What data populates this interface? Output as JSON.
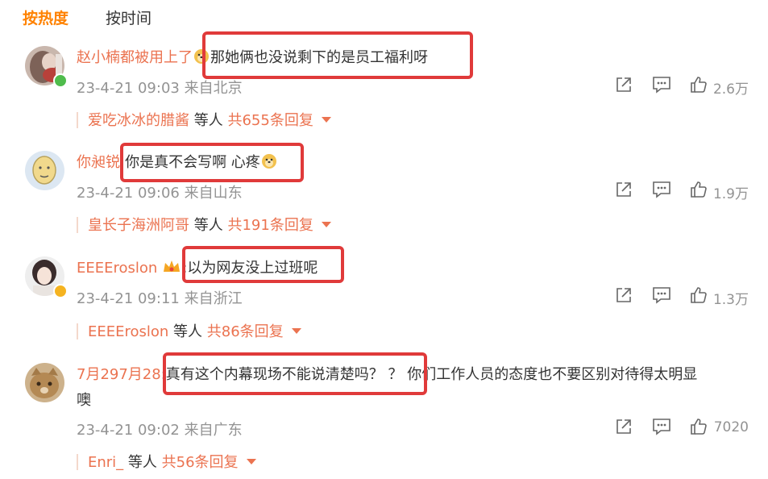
{
  "tabs": {
    "hot": "按热度",
    "time": "按时间"
  },
  "colors": {
    "accent": "#ff8200",
    "username": "#eb7350",
    "meta": "#939393",
    "highlight_box": "#e03a3a"
  },
  "comments": [
    {
      "username": "赵小楠都被用上了",
      "separator": "",
      "text_before_emoji": "",
      "emoji": "doge-emoji",
      "text": "那她俩也没说剩下的是员工福利呀",
      "time": "23-4-21 09:03",
      "location": "来自北京",
      "likes": "2.6万",
      "reply": {
        "name": "爱吃冰冰的腊酱",
        "mid": "等人",
        "count": "共655条回复"
      }
    },
    {
      "username": "你昶锐",
      "separator": ":",
      "text": "你是真不会写啊 心疼",
      "emoji": "doge-emoji",
      "time": "23-4-21 09:06",
      "location": "来自山东",
      "likes": "1.9万",
      "reply": {
        "name": "皇长子海洲阿哥",
        "mid": "等人",
        "count": "共191条回复"
      }
    },
    {
      "username": "EEEEroslon",
      "badge_icon": "crown-badge-icon",
      "separator": ":",
      "text": "以为网友没上过班呢",
      "time": "23-4-21 09:11",
      "location": "来自浙江",
      "likes": "1.3万",
      "reply": {
        "name": "EEEEroslon",
        "mid": "等人",
        "count": "共86条回复"
      }
    },
    {
      "username": "7月297月28",
      "separator": ":",
      "text": "真有这个内幕现场不能说清楚吗？ ？",
      "text_cont": " 你们工作人员的态度也不要区别对待得太明显",
      "text_line2": "噢",
      "time": "23-4-21 09:02",
      "location": "来自广东",
      "likes": "7020",
      "reply": {
        "name": "Enri_",
        "mid": "等人",
        "count": "共56条回复"
      }
    }
  ]
}
